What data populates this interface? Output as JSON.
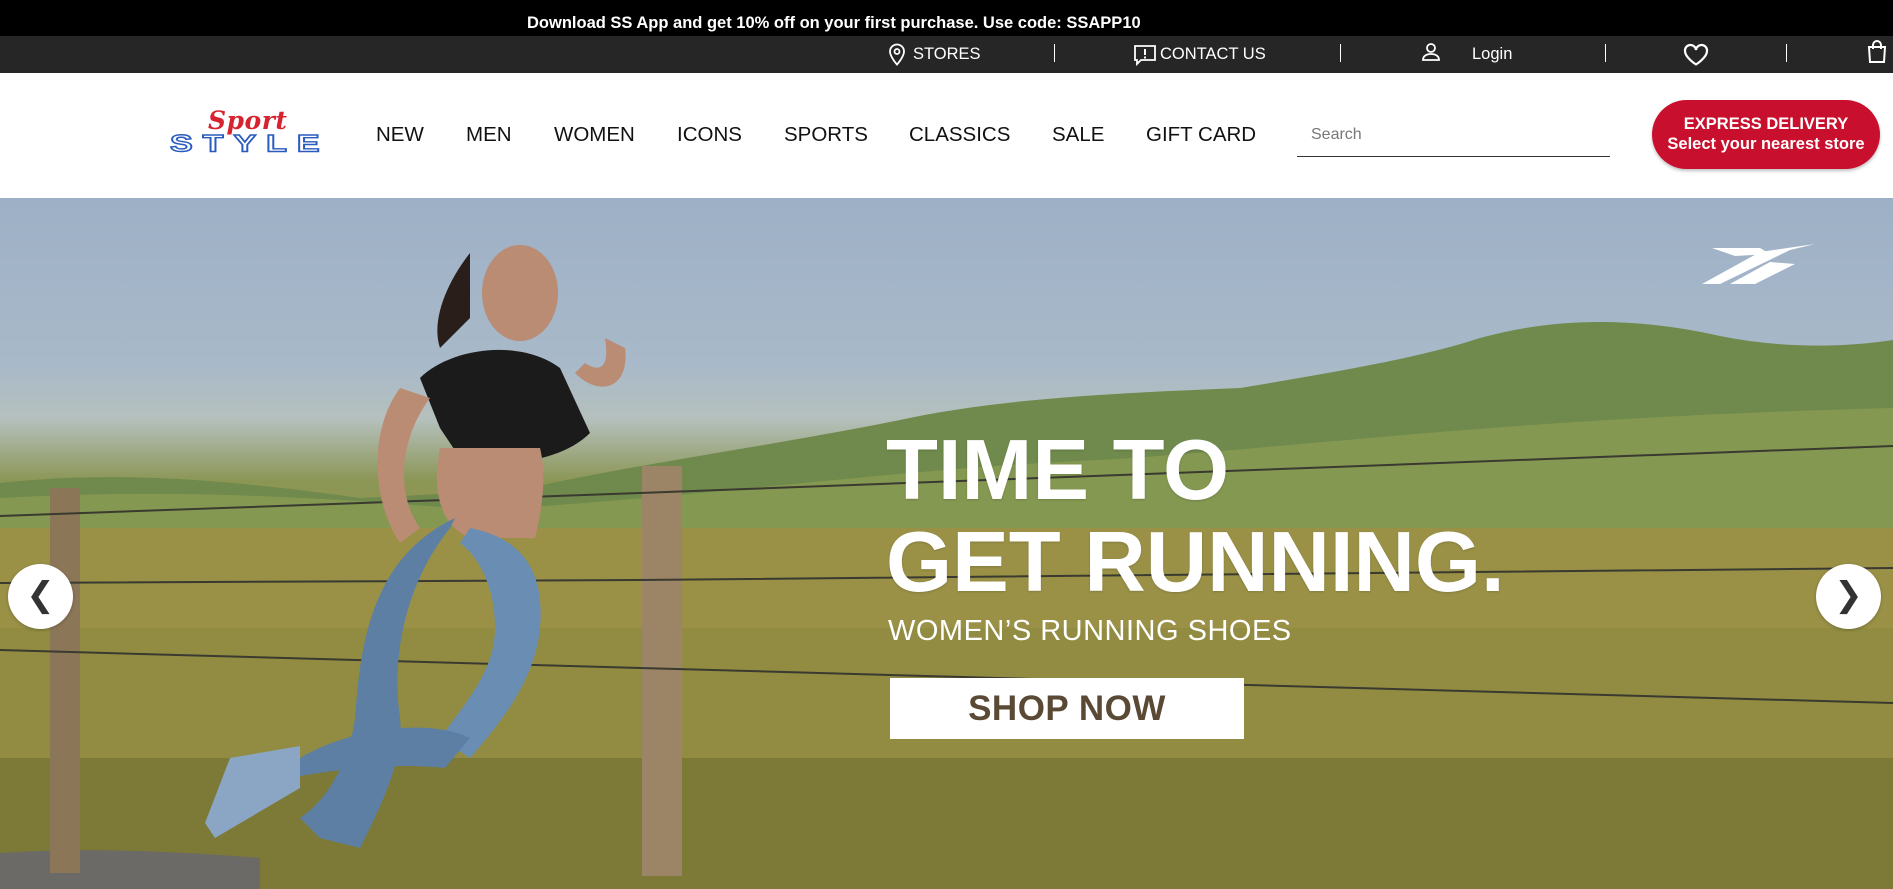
{
  "promo": {
    "text": "Download SS App and get 10% off on your first purchase. Use code: SSAPP10"
  },
  "utility_nav": {
    "stores_label": "STORES",
    "contact_label": "CONTACT US",
    "login_label": "Login"
  },
  "logo": {
    "top": "Sport",
    "bottom": "STYLE"
  },
  "main_nav": {
    "items": [
      {
        "label": "NEW"
      },
      {
        "label": "MEN"
      },
      {
        "label": "WOMEN"
      },
      {
        "label": "ICONS"
      },
      {
        "label": "SPORTS"
      },
      {
        "label": "CLASSICS"
      },
      {
        "label": "SALE"
      },
      {
        "label": "GIFT CARD"
      }
    ]
  },
  "search": {
    "placeholder": "Search",
    "value": ""
  },
  "express": {
    "title": "EXPRESS DELIVERY",
    "subtitle": "Select your nearest store"
  },
  "hero": {
    "title_line1": "TIME TO",
    "title_line2": "GET RUNNING.",
    "subtitle": "WOMEN’S RUNNING SHOES",
    "cta": "SHOP NOW",
    "prev_arrow": "❮",
    "next_arrow": "❯"
  },
  "colors": {
    "promo_bg": "#000000",
    "utility_bg": "#262626",
    "express_bg": "#c8102e",
    "logo_red": "#d7222f",
    "logo_blue": "#2a5bbf",
    "cta_text": "#5a4a35"
  },
  "icons": [
    "location-pin-icon",
    "contact-chat-icon",
    "user-icon",
    "heart-icon",
    "shopping-bag-icon",
    "reebok-logo-icon",
    "chevron-left-icon",
    "chevron-right-icon"
  ]
}
